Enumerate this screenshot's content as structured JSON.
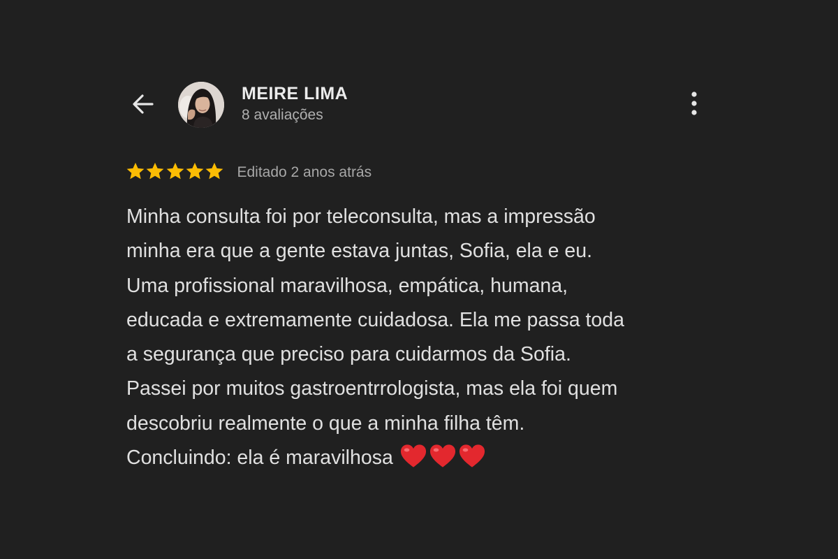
{
  "header": {
    "back_icon": "arrow-left-icon",
    "reviewer_name": "MEIRE LIMA",
    "reviewer_review_count": "8 avaliações",
    "more_icon": "more-vertical-icon"
  },
  "rating": {
    "stars": 5,
    "max_stars": 5,
    "star_color": "#fbbc04",
    "date_label": "Editado 2 anos atrás"
  },
  "review": {
    "lines": [
      "Minha consulta foi por teleconsulta, mas a impressão",
      "minha era que a gente estava juntas, Sofia, ela e eu.",
      "Uma profissional maravilhosa, empática, humana,",
      "educada e extremamente cuidadosa. Ela me passa toda",
      "a segurança que preciso para cuidarmos da Sofia.",
      "Passei por muitos gastroentrrologista, mas ela foi quem",
      "descobriu realmente o que a minha filha têm.",
      "Concluindo: ela é maravilhosa"
    ],
    "trailing_emoji": "heart-emoji",
    "trailing_emoji_count": 3,
    "heart_color": "#e3282e"
  },
  "colors": {
    "background": "#202020",
    "primary_text": "#e0e0e0",
    "secondary_text": "#a8a8a8"
  }
}
